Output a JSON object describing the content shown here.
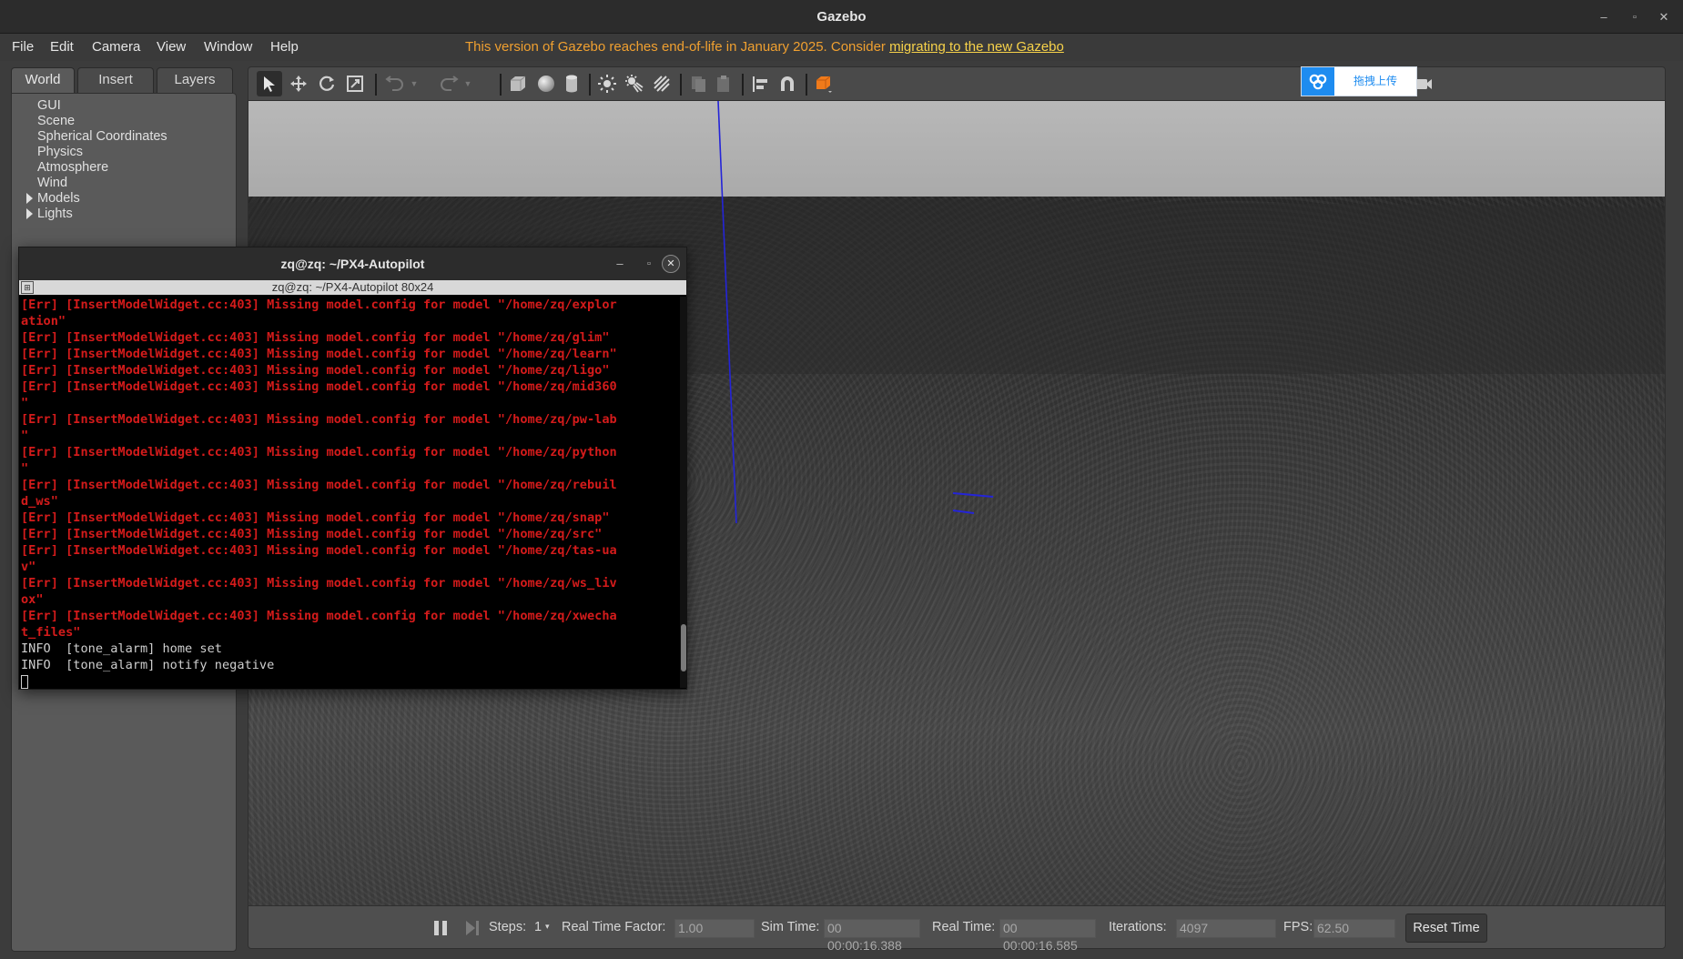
{
  "window": {
    "title": "Gazebo"
  },
  "menubar": {
    "items": [
      "File",
      "Edit",
      "Camera",
      "View",
      "Window",
      "Help"
    ],
    "notice_text": "This version of Gazebo reaches end-of-life in January 2025. Consider ",
    "notice_link": "migrating to the new Gazebo"
  },
  "left_panel": {
    "tabs": [
      "World",
      "Insert",
      "Layers"
    ],
    "active_tab": "World",
    "tree": [
      "GUI",
      "Scene",
      "Spherical Coordinates",
      "Physics",
      "Atmosphere",
      "Wind",
      "Models",
      "Lights"
    ]
  },
  "toolbar": {
    "icons": [
      "select-arrow-icon",
      "translate-icon",
      "rotate-icon",
      "scale-icon",
      "undo-icon",
      "redo-icon",
      "box-icon",
      "sphere-icon",
      "cylinder-icon",
      "point-light-icon",
      "spot-light-icon",
      "directional-light-icon",
      "copy-icon",
      "paste-icon",
      "align-icon",
      "magnet-icon",
      "view-angle-icon",
      "screenshot-icon",
      "log-icon",
      "plot-icon",
      "video-record-icon"
    ]
  },
  "upload_widget": {
    "label": "拖拽上传"
  },
  "terminal": {
    "title": "zq@zq: ~/PX4-Autopilot",
    "subtitle": "zq@zq: ~/PX4-Autopilot 80x24",
    "lines": [
      {
        "type": "err",
        "text": "[Err] [InsertModelWidget.cc:403] Missing model.config for model \"/home/zq/explor"
      },
      {
        "type": "err",
        "text": "ation\""
      },
      {
        "type": "err",
        "text": "[Err] [InsertModelWidget.cc:403] Missing model.config for model \"/home/zq/glim\""
      },
      {
        "type": "err",
        "text": "[Err] [InsertModelWidget.cc:403] Missing model.config for model \"/home/zq/learn\""
      },
      {
        "type": "err",
        "text": "[Err] [InsertModelWidget.cc:403] Missing model.config for model \"/home/zq/ligo\""
      },
      {
        "type": "err",
        "text": "[Err] [InsertModelWidget.cc:403] Missing model.config for model \"/home/zq/mid360"
      },
      {
        "type": "err",
        "text": "\""
      },
      {
        "type": "err",
        "text": "[Err] [InsertModelWidget.cc:403] Missing model.config for model \"/home/zq/pw-lab"
      },
      {
        "type": "err",
        "text": "\""
      },
      {
        "type": "err",
        "text": "[Err] [InsertModelWidget.cc:403] Missing model.config for model \"/home/zq/python"
      },
      {
        "type": "err",
        "text": "\""
      },
      {
        "type": "err",
        "text": "[Err] [InsertModelWidget.cc:403] Missing model.config for model \"/home/zq/rebuil"
      },
      {
        "type": "err",
        "text": "d_ws\""
      },
      {
        "type": "err",
        "text": "[Err] [InsertModelWidget.cc:403] Missing model.config for model \"/home/zq/snap\""
      },
      {
        "type": "err",
        "text": "[Err] [InsertModelWidget.cc:403] Missing model.config for model \"/home/zq/src\""
      },
      {
        "type": "err",
        "text": "[Err] [InsertModelWidget.cc:403] Missing model.config for model \"/home/zq/tas-ua"
      },
      {
        "type": "err",
        "text": "v\""
      },
      {
        "type": "err",
        "text": "[Err] [InsertModelWidget.cc:403] Missing model.config for model \"/home/zq/ws_liv"
      },
      {
        "type": "err",
        "text": "ox\""
      },
      {
        "type": "err",
        "text": "[Err] [InsertModelWidget.cc:403] Missing model.config for model \"/home/zq/xwecha"
      },
      {
        "type": "err",
        "text": "t_files\""
      },
      {
        "type": "info",
        "text": "INFO  [tone_alarm] home set"
      },
      {
        "type": "info",
        "text": "INFO  [tone_alarm] notify negative"
      }
    ]
  },
  "statusbar": {
    "steps_label": "Steps:",
    "steps_value": "1",
    "rtf_label": "Real Time Factor:",
    "rtf_value": "1.00",
    "sim_time_label": "Sim Time:",
    "sim_time_value": "00 00:00:16.388",
    "real_time_label": "Real Time:",
    "real_time_value": "00 00:00:16.585",
    "iterations_label": "Iterations:",
    "iterations_value": "4097",
    "fps_label": "FPS:",
    "fps_value": "62.50",
    "reset_label": "Reset Time"
  },
  "colors": {
    "error_text": "#d41b1b",
    "notice_text": "#f0a030",
    "upload_accent": "#1e8cf0",
    "axis_line": "#2424d8"
  }
}
